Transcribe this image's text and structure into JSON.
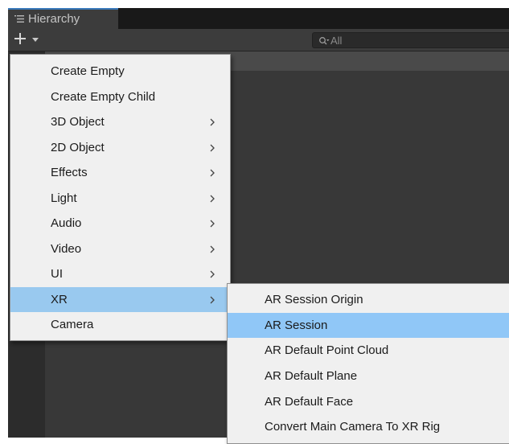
{
  "panel": {
    "tab_title": "Hierarchy",
    "tab_icon": "list-icon",
    "add_button_icon": "plus-icon",
    "search": {
      "placeholder": "All",
      "icon": "search-filter-icon"
    }
  },
  "context_menu": {
    "items": [
      {
        "label": "Create Empty",
        "submenu": false
      },
      {
        "label": "Create Empty Child",
        "submenu": false
      },
      {
        "label": "3D Object",
        "submenu": true
      },
      {
        "label": "2D Object",
        "submenu": true
      },
      {
        "label": "Effects",
        "submenu": true
      },
      {
        "label": "Light",
        "submenu": true
      },
      {
        "label": "Audio",
        "submenu": true
      },
      {
        "label": "Video",
        "submenu": true
      },
      {
        "label": "UI",
        "submenu": true
      },
      {
        "label": "XR",
        "submenu": true,
        "highlighted": true
      },
      {
        "label": "Camera",
        "submenu": false
      }
    ]
  },
  "xr_submenu": {
    "items": [
      {
        "label": "AR Session Origin"
      },
      {
        "label": "AR Session",
        "highlighted": true
      },
      {
        "label": "AR Default Point Cloud"
      },
      {
        "label": "AR Default Plane"
      },
      {
        "label": "AR Default Face"
      },
      {
        "label": "Convert Main Camera To XR Rig"
      }
    ]
  },
  "colors": {
    "editor_bg": "#383838",
    "menu_bg": "#f0f0f0",
    "highlight_main": "#99c9ef",
    "highlight_sub": "#90c7f7",
    "tab_accent": "#3a79bb"
  }
}
